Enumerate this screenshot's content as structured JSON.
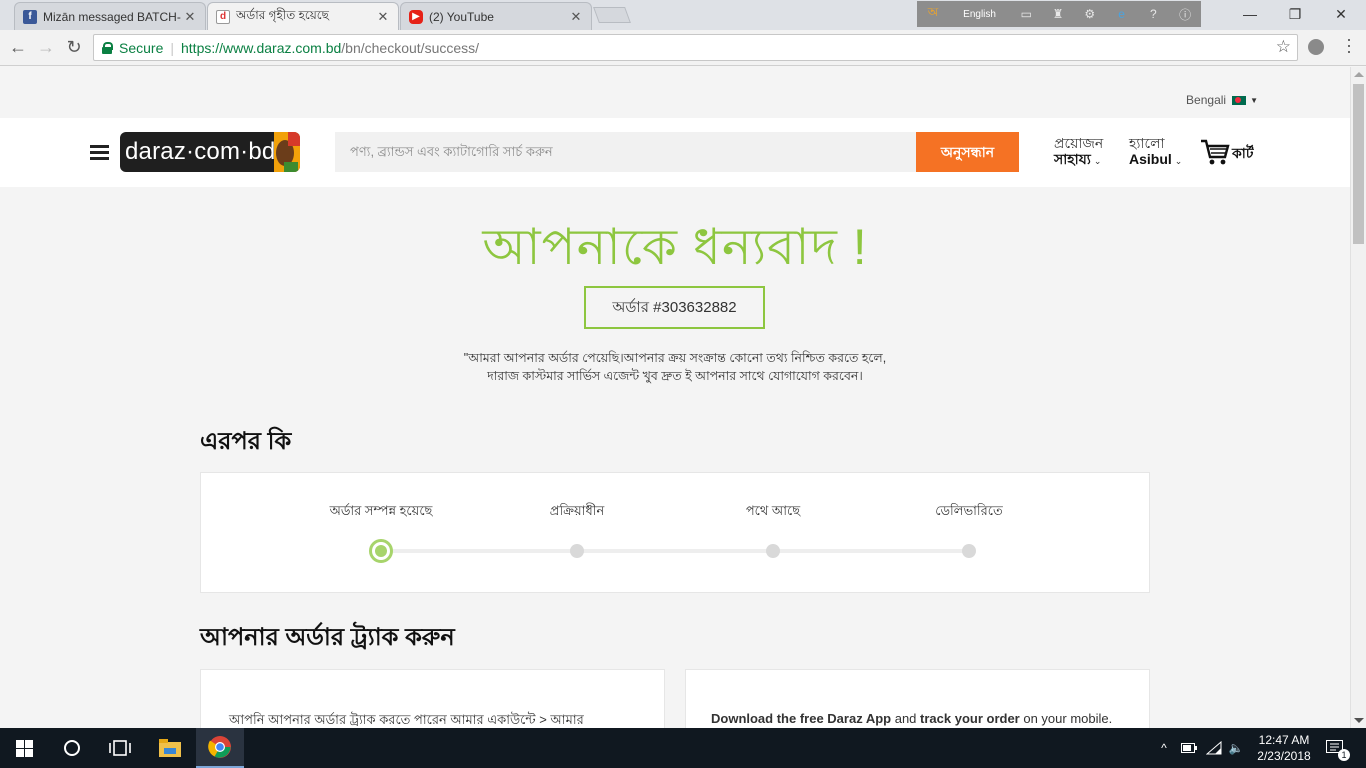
{
  "browser": {
    "tabs": [
      {
        "title": "Mizān messaged BATCH-",
        "icon": "facebook-icon",
        "active": false
      },
      {
        "title": "অর্ডার গৃহীত হয়েছে",
        "icon": "daraz-icon",
        "active": true
      },
      {
        "title": "(2) YouTube",
        "icon": "youtube-icon",
        "active": false
      }
    ],
    "ime": {
      "language": "English"
    },
    "address": {
      "secure_label": "Secure",
      "host": "https://www.daraz.com.bd",
      "path": "/bn/checkout/success/"
    }
  },
  "page": {
    "language": "Bengali",
    "header": {
      "logo_text": "daraz·com·bd",
      "search_placeholder": "পণ্য, ব্র্যান্ডস এবং ক্যাটাগোরি সার্চ করুন",
      "search_button": "অনুসন্ধান",
      "help_top": "প্রয়োজন",
      "help_bottom": "সাহায্য",
      "account_top": "হ্যালো",
      "account_bottom": "Asibul",
      "cart_label": "কার্ট"
    },
    "thanks": "আপনাকে ধন্যবাদ !",
    "order_number": "অর্ডার #303632882",
    "note_line1": "\"আমরা আপনার অর্ডার পেয়েছি।আপনার ক্রয় সংক্রান্ত কোনো তথ্য নিশ্চিত করতে হলে,",
    "note_line2": "দারাজ কাস্টমার সার্ভিস এজেন্ট খুব দ্রুত ই আপনার সাথে যোগাযোগ করবেন।",
    "next_heading": "এরপর কি",
    "steps": [
      {
        "label": "অর্ডার সম্পন্ন হয়েছে",
        "done": true
      },
      {
        "label": "প্রক্রিয়াধীন",
        "done": false
      },
      {
        "label": "পথে আছে",
        "done": false
      },
      {
        "label": "ডেলিভারিতে",
        "done": false
      }
    ],
    "track_heading": "আপনার অর্ডার ট্র্যাক করুন",
    "track_left_text": "আপনি আপনার অর্ডার ট্র্যাক করতে পারেন আমার একাউন্টে > আমার",
    "track_right": {
      "bold1": "Download the free Daraz App",
      "mid": " and ",
      "bold2": "track your order",
      "end": " on your mobile."
    }
  },
  "taskbar": {
    "time": "12:47 AM",
    "date": "2/23/2018",
    "notification_count": "1"
  },
  "colors": {
    "brand_orange": "#f57224",
    "success_green": "#8dc63f"
  }
}
